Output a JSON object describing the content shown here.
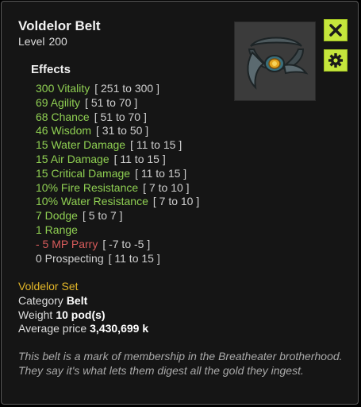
{
  "item": {
    "name": "Voldelor Belt",
    "level_label": "Level",
    "level": "200",
    "effects_heading": "Effects",
    "effects": [
      {
        "text": "300 Vitality",
        "range": "[ 251 to 300 ]",
        "kind": "main"
      },
      {
        "text": "69 Agility",
        "range": "[ 51 to 70 ]",
        "kind": "main"
      },
      {
        "text": "68 Chance",
        "range": "[ 51 to 70 ]",
        "kind": "main"
      },
      {
        "text": "46 Wisdom",
        "range": "[ 31 to 50 ]",
        "kind": "main"
      },
      {
        "text": "15 Water Damage",
        "range": "[ 11 to 15 ]",
        "kind": "main"
      },
      {
        "text": "15 Air Damage",
        "range": "[ 11 to 15 ]",
        "kind": "main"
      },
      {
        "text": "15 Critical Damage",
        "range": "[ 11 to 15 ]",
        "kind": "main"
      },
      {
        "text": "10% Fire Resistance",
        "range": "[ 7 to 10 ]",
        "kind": "main"
      },
      {
        "text": "10% Water Resistance",
        "range": "[ 7 to 10 ]",
        "kind": "main"
      },
      {
        "text": "7 Dodge",
        "range": "[ 5 to 7 ]",
        "kind": "main"
      },
      {
        "text": "1 Range",
        "range": "",
        "kind": "main"
      },
      {
        "text": "- 5 MP Parry",
        "range": "[ -7 to -5 ]",
        "kind": "neg"
      },
      {
        "text": "0 Prospecting",
        "range": "[ 11 to 15 ]",
        "kind": "neutral"
      }
    ],
    "set_name": "Voldelor Set",
    "category_label": "Category",
    "category": "Belt",
    "weight_label": "Weight",
    "weight": "10 pod(s)",
    "price_label": "Average price",
    "price": "3,430,699 k",
    "description": "This belt is a mark of membership in the Breatheater brotherhood. They say it's what lets them digest all the gold they ingest."
  },
  "buttons": {
    "close_icon": "close-x-icon",
    "settings_icon": "gear-icon"
  },
  "colors": {
    "effect_main": "#8fcf52",
    "effect_negative": "#d75b5b",
    "effect_neutral": "#cfcfcf",
    "set_name": "#e3b628",
    "button_bg": "#c5e63c"
  }
}
